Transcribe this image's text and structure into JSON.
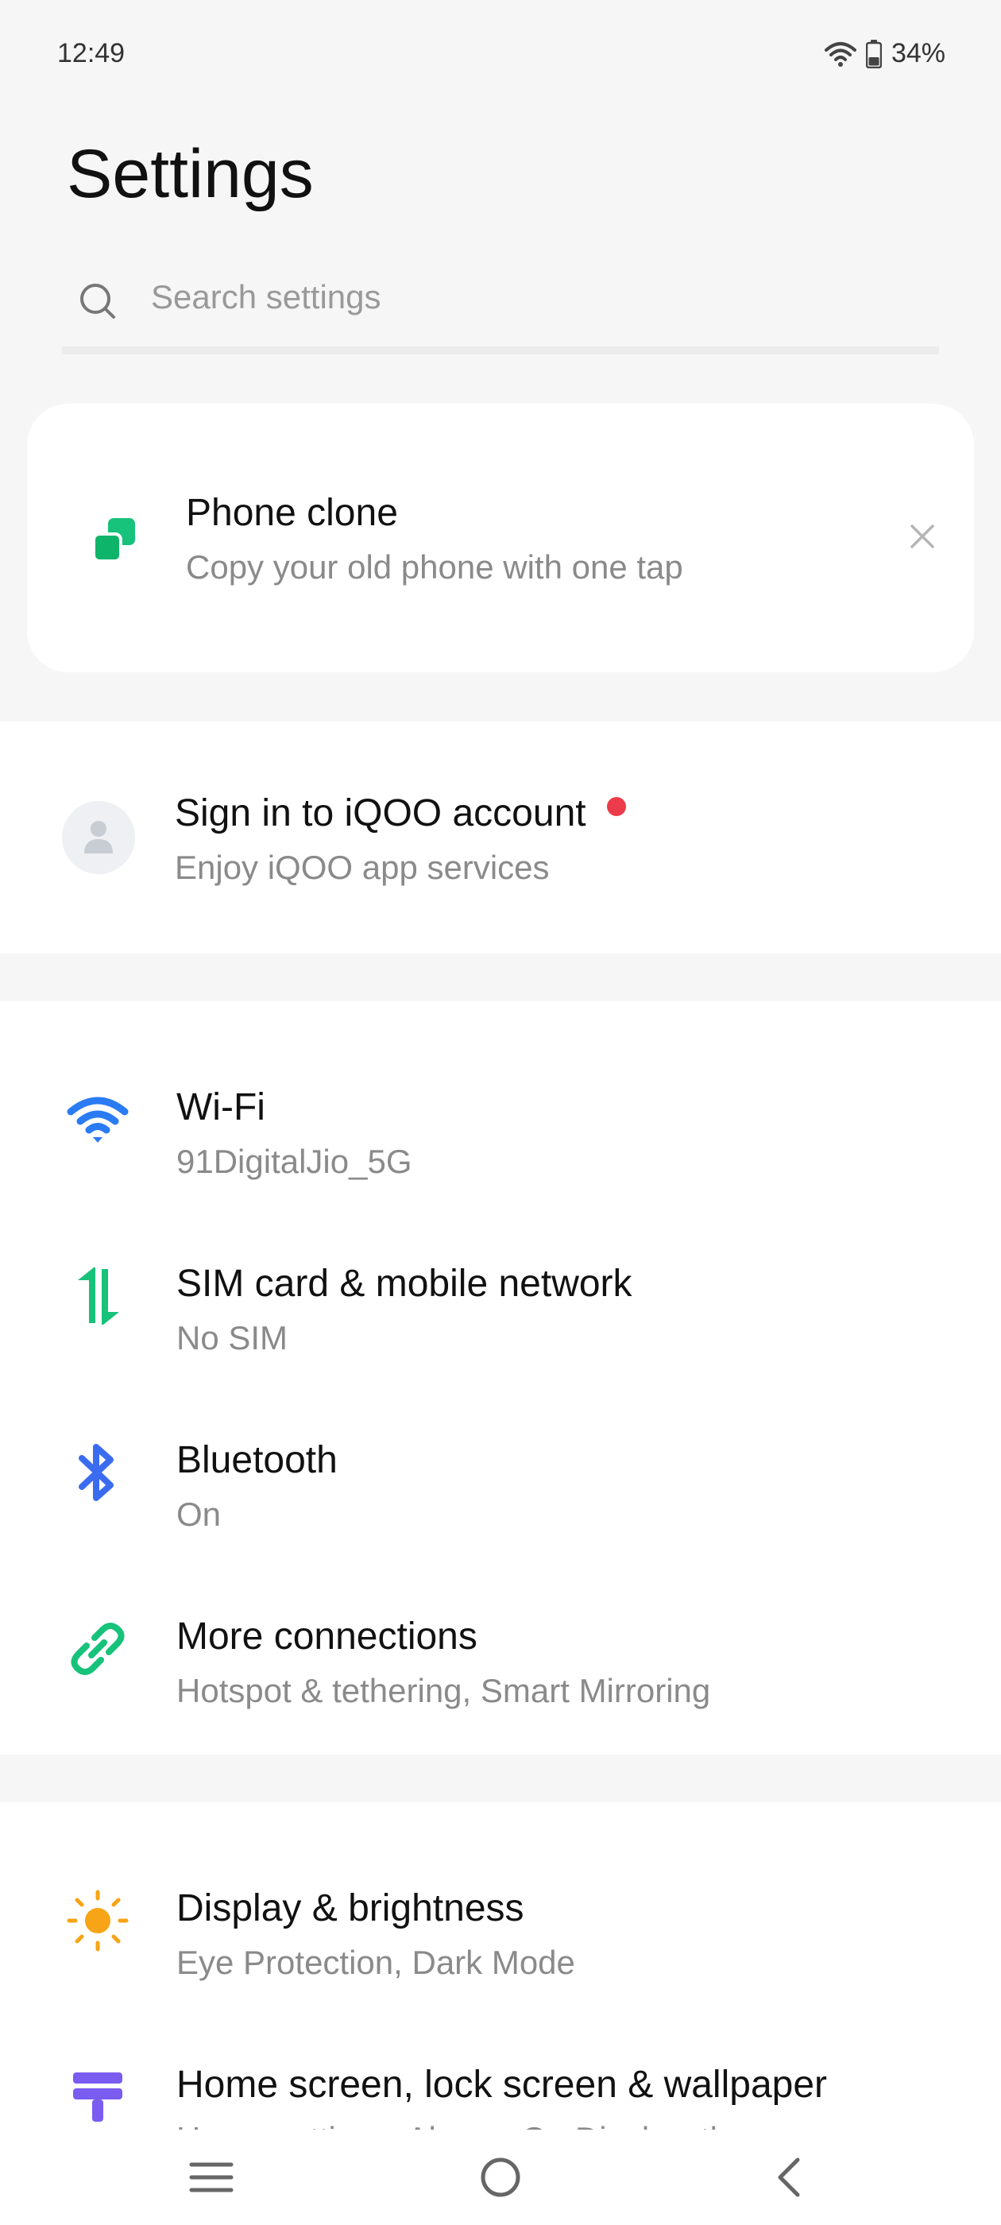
{
  "status_bar": {
    "time": "12:49",
    "battery": "34%"
  },
  "page_title": "Settings",
  "search": {
    "placeholder": "Search settings"
  },
  "phone_clone": {
    "title": "Phone clone",
    "subtitle": "Copy your old phone with one tap"
  },
  "account": {
    "title": "Sign in to iQOO account",
    "subtitle": "Enjoy iQOO app services"
  },
  "connections": [
    {
      "title": "Wi-Fi",
      "subtitle": "91DigitalJio_5G",
      "icon": "wifi-icon"
    },
    {
      "title": "SIM card & mobile network",
      "subtitle": "No SIM",
      "icon": "mobile-data-icon"
    },
    {
      "title": "Bluetooth",
      "subtitle": "On",
      "icon": "bluetooth-icon"
    },
    {
      "title": "More connections",
      "subtitle": "Hotspot & tethering, Smart Mirroring",
      "icon": "link-icon"
    }
  ],
  "display": [
    {
      "title": "Display & brightness",
      "subtitle": "Eye Protection, Dark Mode",
      "icon": "sun-icon"
    },
    {
      "title": "Home screen, lock screen & wallpaper",
      "subtitle": "Home settings, Always On Display, themes",
      "icon": "theme-icon"
    }
  ],
  "colors": {
    "wifi": "#2a7bf4",
    "sim": "#17c27a",
    "bluetooth": "#3b6cf0",
    "link": "#17c27a",
    "sun": "#f7a416",
    "theme": "#7a5cf0",
    "notification_dot": "#ec3b4a"
  }
}
